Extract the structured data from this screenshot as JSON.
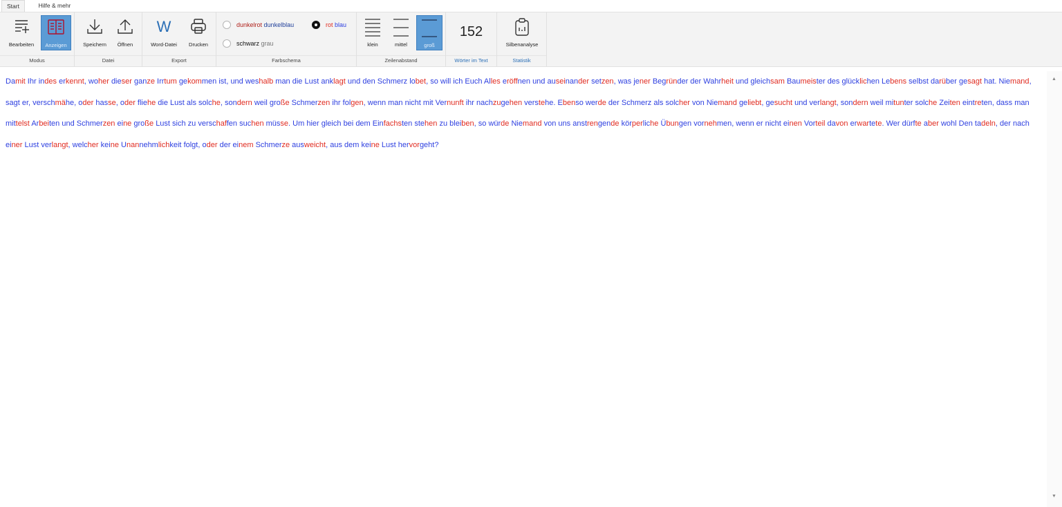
{
  "tabs": {
    "start": "Start",
    "help": "Hilfe & mehr"
  },
  "ribbon": {
    "modus": {
      "label": "Modus",
      "edit": "Bearbeiten",
      "view": "Anzeigen"
    },
    "datei": {
      "label": "Datei",
      "save": "Speichern",
      "open": "Öffnen"
    },
    "export": {
      "label": "Export",
      "word": "Word-Datei",
      "print": "Drucken"
    },
    "farbschema": {
      "label": "Farbschema",
      "opt1a": "dunkelrot",
      "opt1b": "dunkelblau",
      "opt2a": "rot",
      "opt2b": "blau",
      "opt3a": "schwarz",
      "opt3b": "grau",
      "selected": "rot blau"
    },
    "zeilenabstand": {
      "label": "Zeilenabstand",
      "small": "klein",
      "medium": "mittel",
      "large": "groß",
      "selected": "groß"
    },
    "woerter": {
      "label": "Wörter im Text",
      "count": "152"
    },
    "statistik": {
      "label": "Statistik",
      "syllable": "Silbenanalyse"
    },
    "colors": {
      "accent": "#5b9bd5",
      "syllable_a": "#2d3fe0",
      "syllable_b": "#e02b20"
    }
  },
  "document": {
    "text": "Damit Ihr indes erkennt, woher dieser ganze Irrtum gekommen ist, und weshalb man die Lust anklagt und den Schmerz lobet, so will ich Euch Alles eröffnen und auseinander setzen, was jener Begründer der Wahrheit und gleichsam Baumeister des glücklichen Lebens selbst darüber gesagt hat. Niemand, sagt er, verschmähe, oder hasse, oder fliehe die Lust als solche, sondern weil große Schmerzen ihr folgen, wenn man nicht mit Vernunft ihr nachzugehen verstehe. Ebenso werde der Schmerz als solcher von Niemand geliebt, gesucht und verlangt, sondern weil mitunter solche Zeiten eintreten, dass man mittelst Arbeiten und Schmerzen eine große Lust sich zu verschaffen suchen müsse. Um hier gleich bei dem Einfachsten stehen zu bleiben, so würde Niemand von uns anstrengende körperliche Übungen vornehmen, wenn er nicht einen Vorteil davon erwartete. Wer dürfte aber wohl Den tadeln, der nach einer Lust verlangt, welcher keine Unannehmlichkeit folgt, oder der einem Schmerze ausweicht, aus dem keine Lust hervorgeht?"
  },
  "scrollbar": {
    "up": "▲",
    "down": "▼"
  }
}
